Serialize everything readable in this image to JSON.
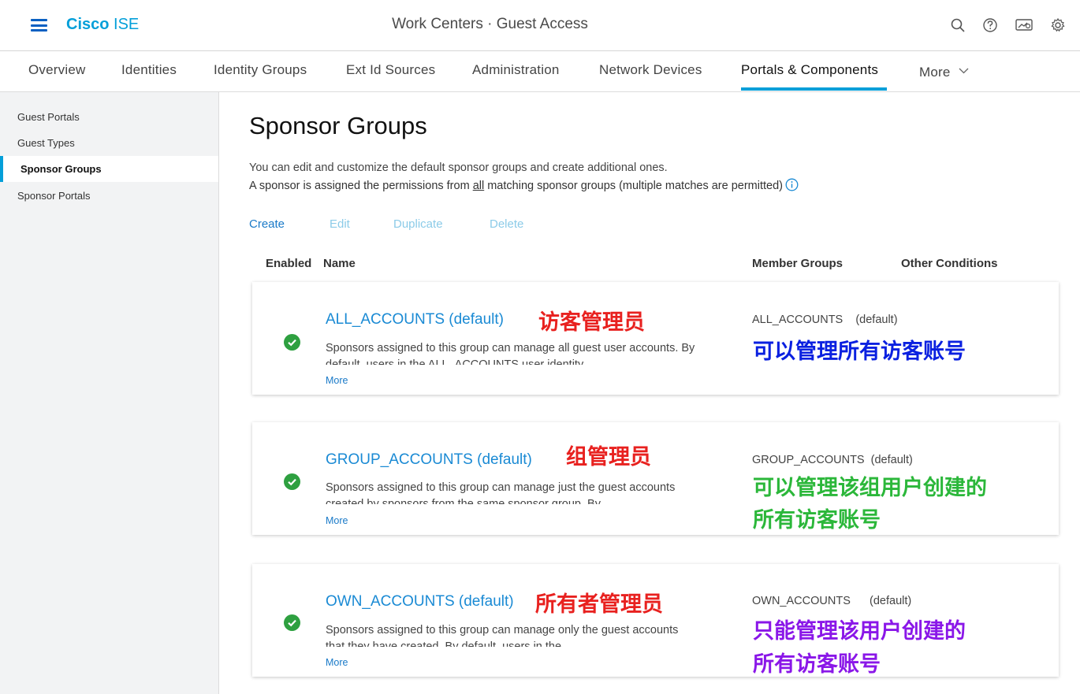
{
  "header": {
    "brand_bold": "Cisco",
    "brand_rest": " ISE",
    "context": "Work Centers · Guest Access",
    "icons": [
      "search-icon",
      "help-icon",
      "dashboard-icon",
      "gear-icon"
    ]
  },
  "tabs": [
    {
      "label": "Overview"
    },
    {
      "label": "Identities"
    },
    {
      "label": "Identity Groups"
    },
    {
      "label": "Ext Id Sources"
    },
    {
      "label": "Administration"
    },
    {
      "label": "Network Devices"
    },
    {
      "label": "Portals & Components",
      "active": true
    },
    {
      "label": "More"
    }
  ],
  "sidebar": {
    "items": [
      {
        "label": "Guest Portals"
      },
      {
        "label": "Guest Types"
      },
      {
        "label": "Sponsor Groups",
        "active": true
      },
      {
        "label": "Sponsor Portals"
      }
    ]
  },
  "main": {
    "title": "Sponsor Groups",
    "desc1": "You can edit and customize the default sponsor groups and create additional ones.",
    "desc2_pre": "A sponsor is assigned the permissions from ",
    "desc2_u": "all",
    "desc2_post": " matching sponsor groups (multiple matches are permitted)",
    "actions": {
      "create": "Create",
      "edit": "Edit",
      "duplicate": "Duplicate",
      "delete": "Delete"
    },
    "columns": {
      "enabled": "Enabled",
      "name": "Name",
      "member_groups": "Member Groups",
      "other_conditions": "Other Conditions"
    },
    "groups": [
      {
        "name": "ALL_ACCOUNTS (default)",
        "description": "Sponsors assigned to this group can manage all guest user accounts. By default, users in the ALL_ACCOUNTS user identity",
        "more": "More",
        "member_group": "ALL_ACCOUNTS    (default)",
        "enabled": true
      },
      {
        "name": "GROUP_ACCOUNTS (default)",
        "description": "Sponsors assigned to this group can manage just the guest accounts created by sponsors from the same sponsor group. By",
        "more": "More",
        "member_group": "GROUP_ACCOUNTS  (default)",
        "enabled": true
      },
      {
        "name": "OWN_ACCOUNTS (default)",
        "description": "Sponsors assigned to this group can manage only the guest accounts that they have created. By default, users in the",
        "more": "More",
        "member_group": "OWN_ACCOUNTS      (default)",
        "enabled": true
      }
    ]
  },
  "annotations": {
    "a1": "访客管理员",
    "a1_note": "可以管理所有访客账号",
    "a2": "组管理员",
    "a2_note_line1": "可以管理该组用户创建的",
    "a2_note_line2": "所有访客账号",
    "a3": "所有者管理员",
    "a3_note_line1": "只能管理该用户创建的",
    "a3_note_line2": "所有访客账号",
    "colors": {
      "red": "#e8211f",
      "blue": "#0a20e0",
      "green": "#2bb73a",
      "purple": "#8a17e8"
    }
  },
  "colors": {
    "accent": "#049fd9",
    "link": "#1a8ad4",
    "success": "#2ea040"
  }
}
